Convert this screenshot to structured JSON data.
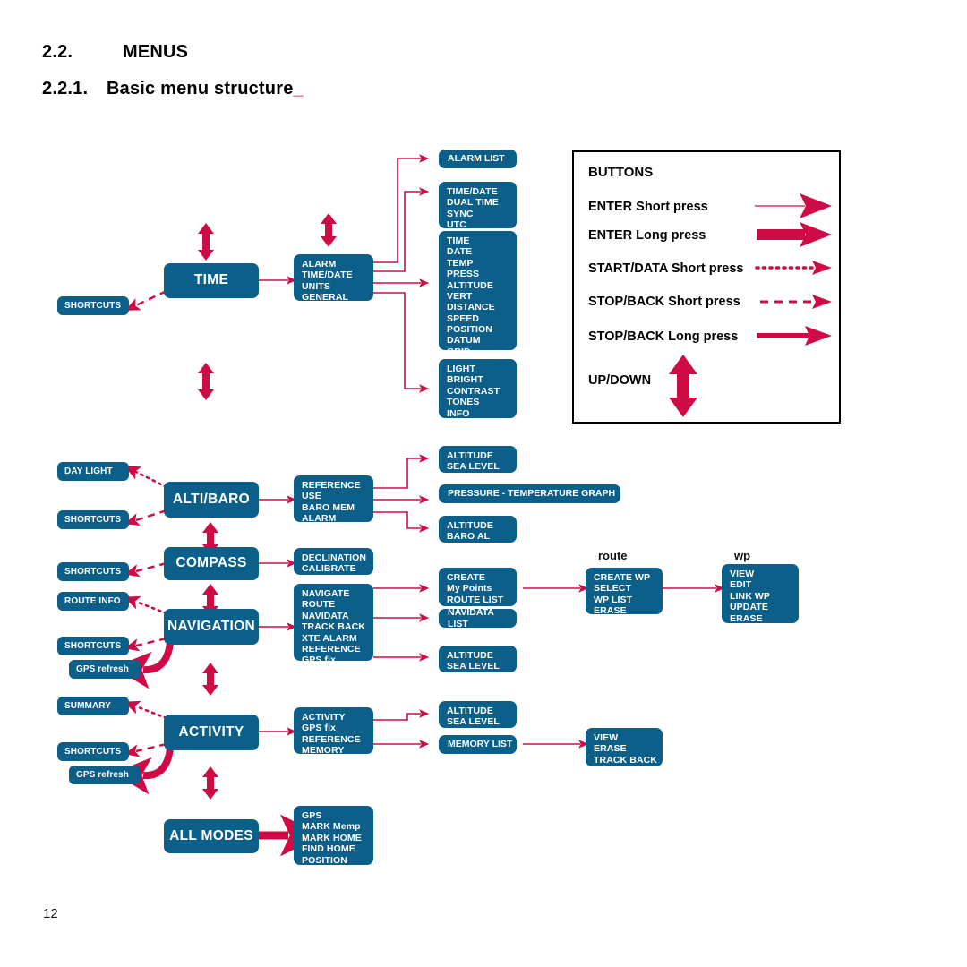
{
  "document": {
    "section_number": "2.2.",
    "section_title": "MENUS",
    "subsection_number": "2.2.1.",
    "subsection_title": "Basic menu structure",
    "page_number": "12"
  },
  "colors": {
    "box_blue": "#0b5f88",
    "accent_red": "#ce0b45",
    "heading_black": "#000000",
    "page_background": "#ffffff"
  },
  "legend": {
    "title": "BUTTONS",
    "rows": [
      {
        "label": "ENTER Short press",
        "arrow": "thin-solid-arrow"
      },
      {
        "label": "ENTER Long press",
        "arrow": "thick-solid-arrow"
      },
      {
        "label": "START/DATA Short press",
        "arrow": "dotted-arrow"
      },
      {
        "label": "STOP/BACK Short press",
        "arrow": "dashed-arrow"
      },
      {
        "label": "STOP/BACK Long press",
        "arrow": "medium-solid-arrow"
      },
      {
        "label": "UP/DOWN",
        "arrow": "up-down-double-arrow"
      }
    ]
  },
  "diagram": {
    "modes": [
      {
        "id": "time",
        "label": "TIME"
      },
      {
        "id": "altibaro",
        "label": "ALTI/BARO"
      },
      {
        "id": "compass",
        "label": "COMPASS"
      },
      {
        "id": "navigation",
        "label": "NAVIGATION"
      },
      {
        "id": "activity",
        "label": "ACTIVITY"
      },
      {
        "id": "allmodes",
        "label": "ALL MODES"
      }
    ],
    "shortcut_boxes": [
      {
        "id": "sc-time",
        "label": "SHORTCUTS"
      },
      {
        "id": "daylight",
        "label": "DAY LIGHT"
      },
      {
        "id": "sc-altibaro",
        "label": "SHORTCUTS"
      },
      {
        "id": "sc-compass",
        "label": "SHORTCUTS"
      },
      {
        "id": "routeinfo",
        "label": "ROUTE INFO"
      },
      {
        "id": "sc-navigation",
        "label": "SHORTCUTS"
      },
      {
        "id": "gps-nav",
        "label": "GPS refresh"
      },
      {
        "id": "summary",
        "label": "SUMMARY"
      },
      {
        "id": "sc-activity",
        "label": "SHORTCUTS"
      },
      {
        "id": "gps-act",
        "label": "GPS refresh"
      }
    ],
    "menus": {
      "time_main": [
        "ALARM",
        "TIME/DATE",
        "UNITS",
        "GENERAL"
      ],
      "time_alarm": [
        "ALARM LIST"
      ],
      "time_timedate": [
        "TIME/DATE",
        "DUAL TIME",
        "SYNC",
        "UTC"
      ],
      "time_units": [
        "TIME",
        "DATE",
        "TEMP",
        "PRESS",
        "ALTITUDE",
        "VERT",
        "DISTANCE",
        "SPEED",
        "POSITION",
        "DATUM",
        "GRID"
      ],
      "time_general": [
        "LIGHT",
        "BRIGHT",
        "CONTRAST",
        "TONES",
        "INFO"
      ],
      "altibaro_main": [
        "REFERENCE",
        "USE",
        "BARO MEM",
        "ALARM"
      ],
      "altibaro_ref": [
        "ALTITUDE",
        "SEA LEVEL"
      ],
      "altibaro_use": [
        "PRESSURE - TEMPERATURE  GRAPH"
      ],
      "altibaro_alarm": [
        "ALTITUDE",
        "BARO AL"
      ],
      "compass_main": [
        "DECLINATION",
        "CALIBRATE"
      ],
      "navigation_main": [
        "NAVIGATE",
        "ROUTE",
        "NAVIDATA",
        "TRACK BACK",
        "XTE ALARM",
        "REFERENCE",
        "GPS fix"
      ],
      "navigation_route": [
        "CREATE",
        "My Points",
        "ROUTE LIST"
      ],
      "navigation_navidata": [
        "NAVIDATA LIST"
      ],
      "navigation_ref": [
        "ALTITUDE",
        "SEA LEVEL"
      ],
      "route_detail": [
        "CREATE WP",
        "SELECT",
        "WP LIST",
        "ERASE"
      ],
      "wp_detail": [
        "VIEW",
        "EDIT",
        "LINK WP",
        "UPDATE",
        "ERASE"
      ],
      "activity_main": [
        "ACTIVITY",
        "GPS fix",
        "REFERENCE",
        "MEMORY"
      ],
      "activity_ref": [
        "ALTITUDE",
        "SEA LEVEL"
      ],
      "activity_memory": [
        "MEMORY LIST"
      ],
      "memory_detail": [
        "VIEW",
        "ERASE",
        "TRACK BACK"
      ],
      "allmodes_main": [
        "GPS",
        "MARK Memp",
        "MARK HOME",
        "FIND HOME",
        "POSITION"
      ]
    },
    "column_labels": [
      {
        "id": "route-label",
        "label": "route"
      },
      {
        "id": "wp-label",
        "label": "wp"
      }
    ]
  }
}
